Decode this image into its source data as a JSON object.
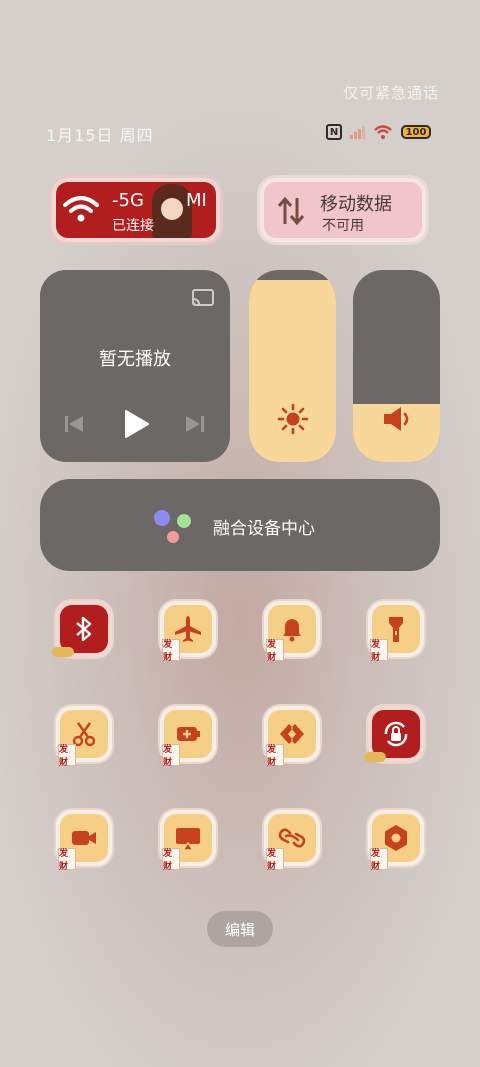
{
  "status": {
    "emergency_text": "仅可紧急通话",
    "date_text": "1月15日 周四",
    "nfc_label": "N",
    "battery_level": "100",
    "colors": {
      "battery": "#f0b32d",
      "signal": "#e39a8c"
    }
  },
  "wifi_tile": {
    "ssid_part1": "-5G",
    "ssid_part2": "MI",
    "state": "已连接",
    "icon": "wifi-icon",
    "active": true,
    "color": "#b21e1e"
  },
  "data_tile": {
    "title": "移动数据",
    "state": "不可用",
    "icon": "mobile-data-arrows-icon",
    "active": false
  },
  "media": {
    "title": "暂无播放",
    "icons": [
      "cast-icon",
      "previous-icon",
      "play-icon",
      "next-icon"
    ]
  },
  "brightness": {
    "level": 0.95,
    "icon": "sun-icon"
  },
  "volume": {
    "level": 0.3,
    "icon": "speaker-icon"
  },
  "device_center": {
    "label": "融合设备中心",
    "dot_colors": [
      "#8c8cf0",
      "#a3e29b",
      "#f39a9a"
    ]
  },
  "toggles": [
    {
      "name": "bluetooth",
      "icon": "bluetooth-icon",
      "active": true
    },
    {
      "name": "airplane-mode",
      "icon": "airplane-icon",
      "active": false
    },
    {
      "name": "sound",
      "icon": "bell-icon",
      "active": false
    },
    {
      "name": "flashlight",
      "icon": "flashlight-icon",
      "active": false
    },
    {
      "name": "screenshot",
      "icon": "scissors-icon",
      "active": false
    },
    {
      "name": "battery-saver",
      "icon": "battery-plus-icon",
      "active": false
    },
    {
      "name": "nearby-share",
      "icon": "share-arrows-icon",
      "active": false
    },
    {
      "name": "rotation-lock",
      "icon": "rotation-lock-icon",
      "active": true
    },
    {
      "name": "screen-record",
      "icon": "video-camera-icon",
      "active": false
    },
    {
      "name": "screen-cast",
      "icon": "screen-cast-icon",
      "active": false
    },
    {
      "name": "link",
      "icon": "link-icon",
      "active": false
    },
    {
      "name": "settings",
      "icon": "hexagon-settings-icon",
      "active": false
    }
  ],
  "toggle_badge": "发财",
  "edit_label": "编辑"
}
